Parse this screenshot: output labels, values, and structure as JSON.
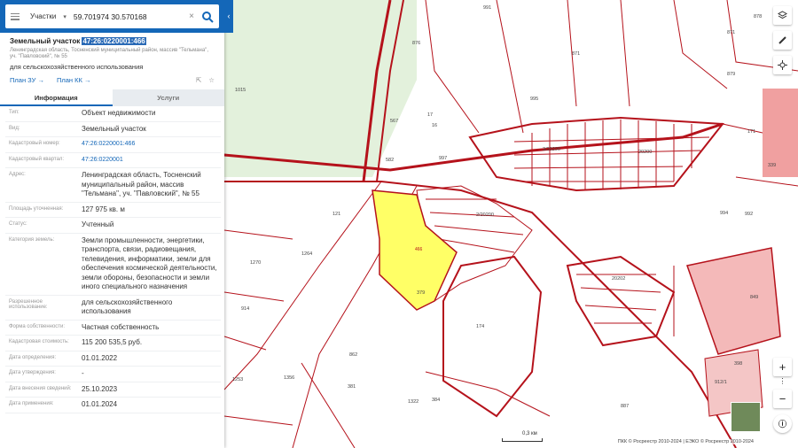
{
  "search": {
    "mode": "Участки",
    "query": "59.701974 30.570168"
  },
  "header": {
    "title_prefix": "Земельный участок",
    "cadastral_number": "47:26:0220001:466",
    "address": "Ленинградская область, Тосненский муниципальный район, массив \"Тельмана\", уч. \"Павловский\", № 55",
    "use": "для сельскохозяйственного использования",
    "plan_zu": "План ЗУ →",
    "plan_kk": "План КК →"
  },
  "tabs": {
    "info": "Информация",
    "services": "Услуги"
  },
  "details": [
    {
      "k": "Тип:",
      "v": "Объект недвижимости"
    },
    {
      "k": "Вид:",
      "v": "Земельный участок"
    },
    {
      "k": "Кадастровый номер:",
      "v": "47:26:0220001:466",
      "link": true
    },
    {
      "k": "Кадастровый квартал:",
      "v": "47:26:0220001",
      "link": true
    },
    {
      "k": "Адрес:",
      "v": "Ленинградская область, Тосненский муниципальный район, массив \"Тельмана\", уч. \"Павловский\", № 55"
    },
    {
      "k": "Площадь уточненная:",
      "v": "127 975 кв. м"
    },
    {
      "k": "Статус:",
      "v": "Учтенный"
    },
    {
      "k": "Категория земель:",
      "v": "Земли промышленности, энергетики, транспорта, связи, радиовещания, телевидения, информатики, земли для обеспечения космической деятельности, земли обороны, безопасности и земли иного специального назначения"
    },
    {
      "k": "Разрешенное использование:",
      "v": "для сельскохозяйственного использования"
    },
    {
      "k": "Форма собственности:",
      "v": "Частная собственность"
    },
    {
      "k": "Кадастровая стоимость:",
      "v": "115 200 535,5 руб."
    },
    {
      "k": "Дата определения:",
      "v": "01.01.2022"
    },
    {
      "k": "Дата утверждения:",
      "v": "-"
    },
    {
      "k": "Дата внесения сведений:",
      "v": "25.10.2023"
    },
    {
      "k": "Дата применения:",
      "v": "01.01.2024"
    }
  ],
  "map": {
    "selected_parcel": "466",
    "labels": [
      "991",
      "876",
      "871",
      "871",
      "878",
      "879",
      "1015",
      "995",
      "567",
      "17",
      "16",
      "582",
      "997",
      "994",
      "171",
      "339",
      "121",
      "1264",
      "1270",
      "914",
      "862",
      "381",
      "1356",
      "1322",
      "384",
      "174",
      "849",
      "398",
      "912/1",
      "1253",
      "887",
      "992",
      "466",
      "379",
      "2/20200",
      "3/20200",
      "20202",
      "20200"
    ],
    "scale_label": "0,3 км",
    "attribution": "ПКК © Росреестр 2010-2024 | ЕЭКО © Росреестр 2010-2024"
  },
  "colors": {
    "accent": "#1467b8",
    "boundary": "#b5121b",
    "selected": "#ffff66",
    "forest": "#e3f1dc"
  }
}
